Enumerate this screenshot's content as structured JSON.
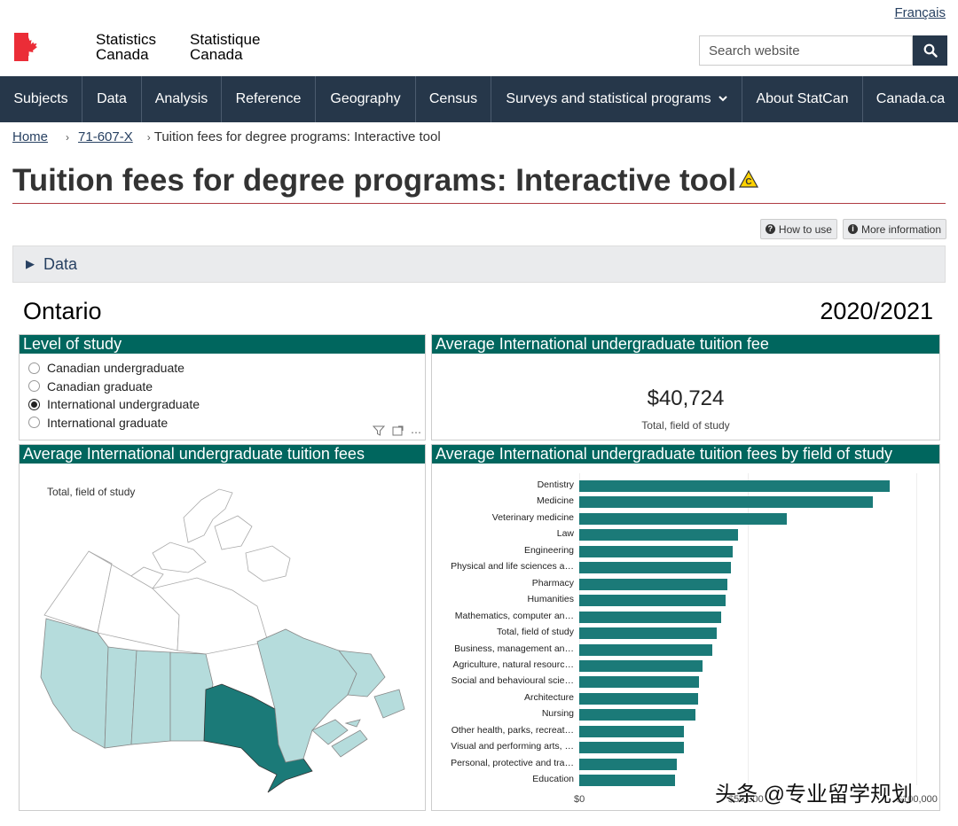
{
  "header": {
    "language_link": "Français",
    "brand_en": [
      "Statistics",
      "Canada"
    ],
    "brand_fr": [
      "Statistique",
      "Canada"
    ],
    "search_placeholder": "Search website"
  },
  "nav": {
    "items": [
      {
        "label": "Subjects"
      },
      {
        "label": "Data"
      },
      {
        "label": "Analysis"
      },
      {
        "label": "Reference"
      },
      {
        "label": "Geography"
      },
      {
        "label": "Census"
      },
      {
        "label": "Surveys and statistical programs"
      },
      {
        "label": "About StatCan"
      },
      {
        "label": "Canada.ca"
      }
    ]
  },
  "breadcrumb": {
    "home": "Home",
    "catalogue": "71-607-X",
    "current": "Tuition fees for degree programs: Interactive tool"
  },
  "page": {
    "title": "Tuition fees for degree programs: Interactive tool",
    "badge": "C",
    "how_to_use": "How to use",
    "more_info": "More information",
    "data_details": "Data"
  },
  "dashboard": {
    "region": "Ontario",
    "year": "2020/2021",
    "level_panel": {
      "title": "Level of study",
      "options": [
        {
          "label": "Canadian undergraduate",
          "selected": false
        },
        {
          "label": "Canadian graduate",
          "selected": false
        },
        {
          "label": "International undergraduate",
          "selected": true
        },
        {
          "label": "International graduate",
          "selected": false
        }
      ]
    },
    "kpi_panel": {
      "title": "Average International undergraduate tuition fee",
      "value": "$40,724",
      "label": "Total, field of study"
    },
    "map_panel": {
      "title": "Average International undergraduate tuition fees",
      "subtitle": "Total, field of study",
      "highlight_color": "#1b7a78",
      "light_color": "#b5dcdc"
    },
    "bar_panel": {
      "title": "Average International undergraduate tuition fees by field of study"
    }
  },
  "chart_data": {
    "type": "bar",
    "orientation": "horizontal",
    "categories": [
      "Dentistry",
      "Medicine",
      "Veterinary medicine",
      "Law",
      "Engineering",
      "Physical and life sciences a…",
      "Pharmacy",
      "Humanities",
      "Mathematics, computer an…",
      "Total, field of study",
      "Business, management an…",
      "Agriculture, natural resourc…",
      "Social and behavioural scie…",
      "Architecture",
      "Nursing",
      "Other health, parks, recreat…",
      "Visual and performing arts, …",
      "Personal, protective and tra…",
      "Education"
    ],
    "values": [
      92000,
      87000,
      61500,
      47000,
      45500,
      45000,
      44000,
      43500,
      42000,
      40724,
      39500,
      36500,
      35500,
      35200,
      34500,
      31000,
      31000,
      29000,
      28500
    ],
    "x_tick_labels": [
      "$0",
      "$50,000",
      "$100,000"
    ],
    "xlim": [
      0,
      100000
    ],
    "color": "#1b7a78"
  },
  "watermark": "头条 @专业留学规划"
}
